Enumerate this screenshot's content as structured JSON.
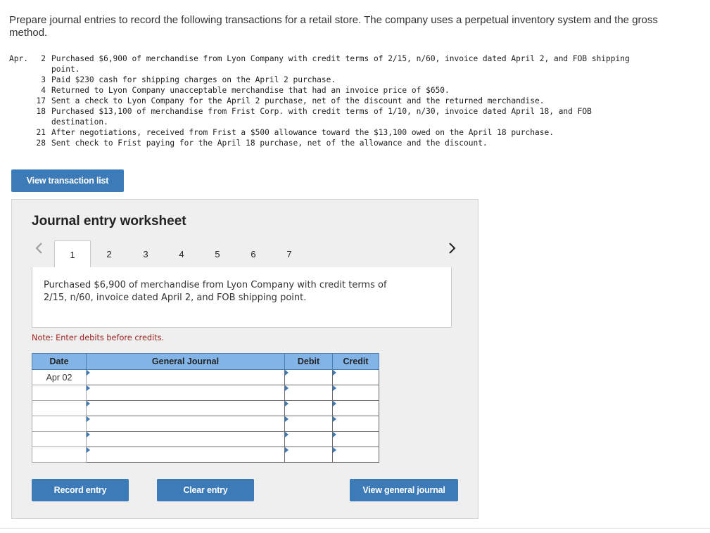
{
  "intro": "Prepare journal entries to record the following transactions for a retail store. The company uses a perpetual inventory system and the gross method.",
  "transactions": {
    "month": "Apr.",
    "items": [
      {
        "day": "2",
        "text": "Purchased $6,900 of merchandise from Lyon Company with credit terms of 2/15, n/60, invoice dated April 2, and FOB shipping",
        "cont": "point."
      },
      {
        "day": "3",
        "text": "Paid $230 cash for shipping charges on the April 2 purchase.",
        "cont": ""
      },
      {
        "day": "4",
        "text": "Returned to Lyon Company unacceptable merchandise that had an invoice price of $650.",
        "cont": ""
      },
      {
        "day": "17",
        "text": "Sent a check to Lyon Company for the April 2 purchase, net of the discount and the returned merchandise.",
        "cont": ""
      },
      {
        "day": "18",
        "text": "Purchased $13,100 of merchandise from Frist Corp. with credit terms of 1/10, n/30, invoice dated April 18, and FOB",
        "cont": "destination."
      },
      {
        "day": "21",
        "text": "After negotiations, received from Frist a $500 allowance toward the $13,100 owed on the April 18 purchase.",
        "cont": ""
      },
      {
        "day": "28",
        "text": "Sent check to Frist paying for the April 18 purchase, net of the allowance and the discount.",
        "cont": ""
      }
    ]
  },
  "buttons": {
    "view_list": "View transaction list",
    "record": "Record entry",
    "clear": "Clear entry",
    "view_journal": "View general journal"
  },
  "worksheet": {
    "title": "Journal entry worksheet",
    "tabs": [
      "1",
      "2",
      "3",
      "4",
      "5",
      "6",
      "7"
    ],
    "active_tab": "1",
    "nav_prev": "<",
    "nav_next": ">",
    "description": "Purchased $6,900 of merchandise from Lyon Company with credit terms of 2/15, n/60, invoice dated April 2, and FOB shipping point.",
    "note": "Note: Enter debits before credits.",
    "table": {
      "headers": {
        "date": "Date",
        "journal": "General Journal",
        "debit": "Debit",
        "credit": "Credit"
      },
      "first_date": "Apr 02"
    }
  },
  "colors": {
    "button_blue": "#3d7ab8",
    "header_blue": "#82b4e8",
    "note_red": "#a02020"
  }
}
